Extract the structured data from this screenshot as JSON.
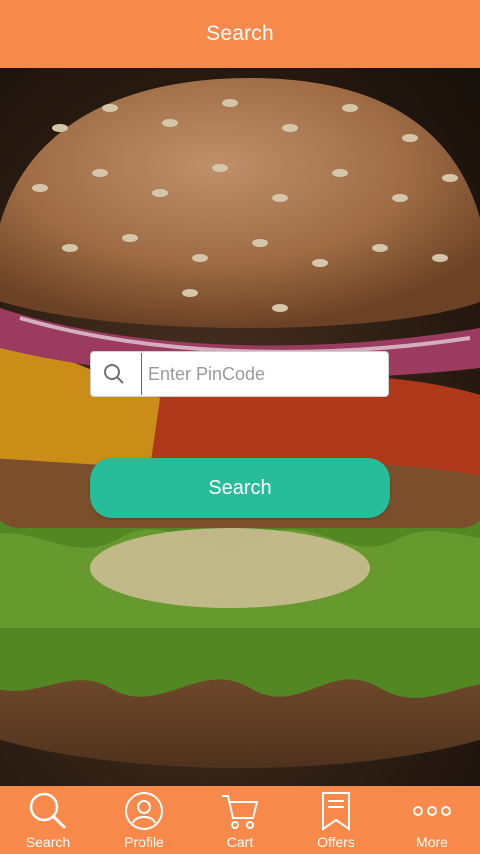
{
  "header": {
    "title": "Search"
  },
  "search": {
    "placeholder": "Enter PinCode",
    "value": "",
    "button_label": "Search"
  },
  "bottom_nav": {
    "items": [
      {
        "label": "Search",
        "icon": "search-icon"
      },
      {
        "label": "Profile",
        "icon": "profile-icon"
      },
      {
        "label": "Cart",
        "icon": "cart-icon"
      },
      {
        "label": "Offers",
        "icon": "offers-icon"
      },
      {
        "label": "More",
        "icon": "more-icon"
      }
    ]
  },
  "colors": {
    "accent": "#F7894A",
    "button": "#27BC9A"
  }
}
